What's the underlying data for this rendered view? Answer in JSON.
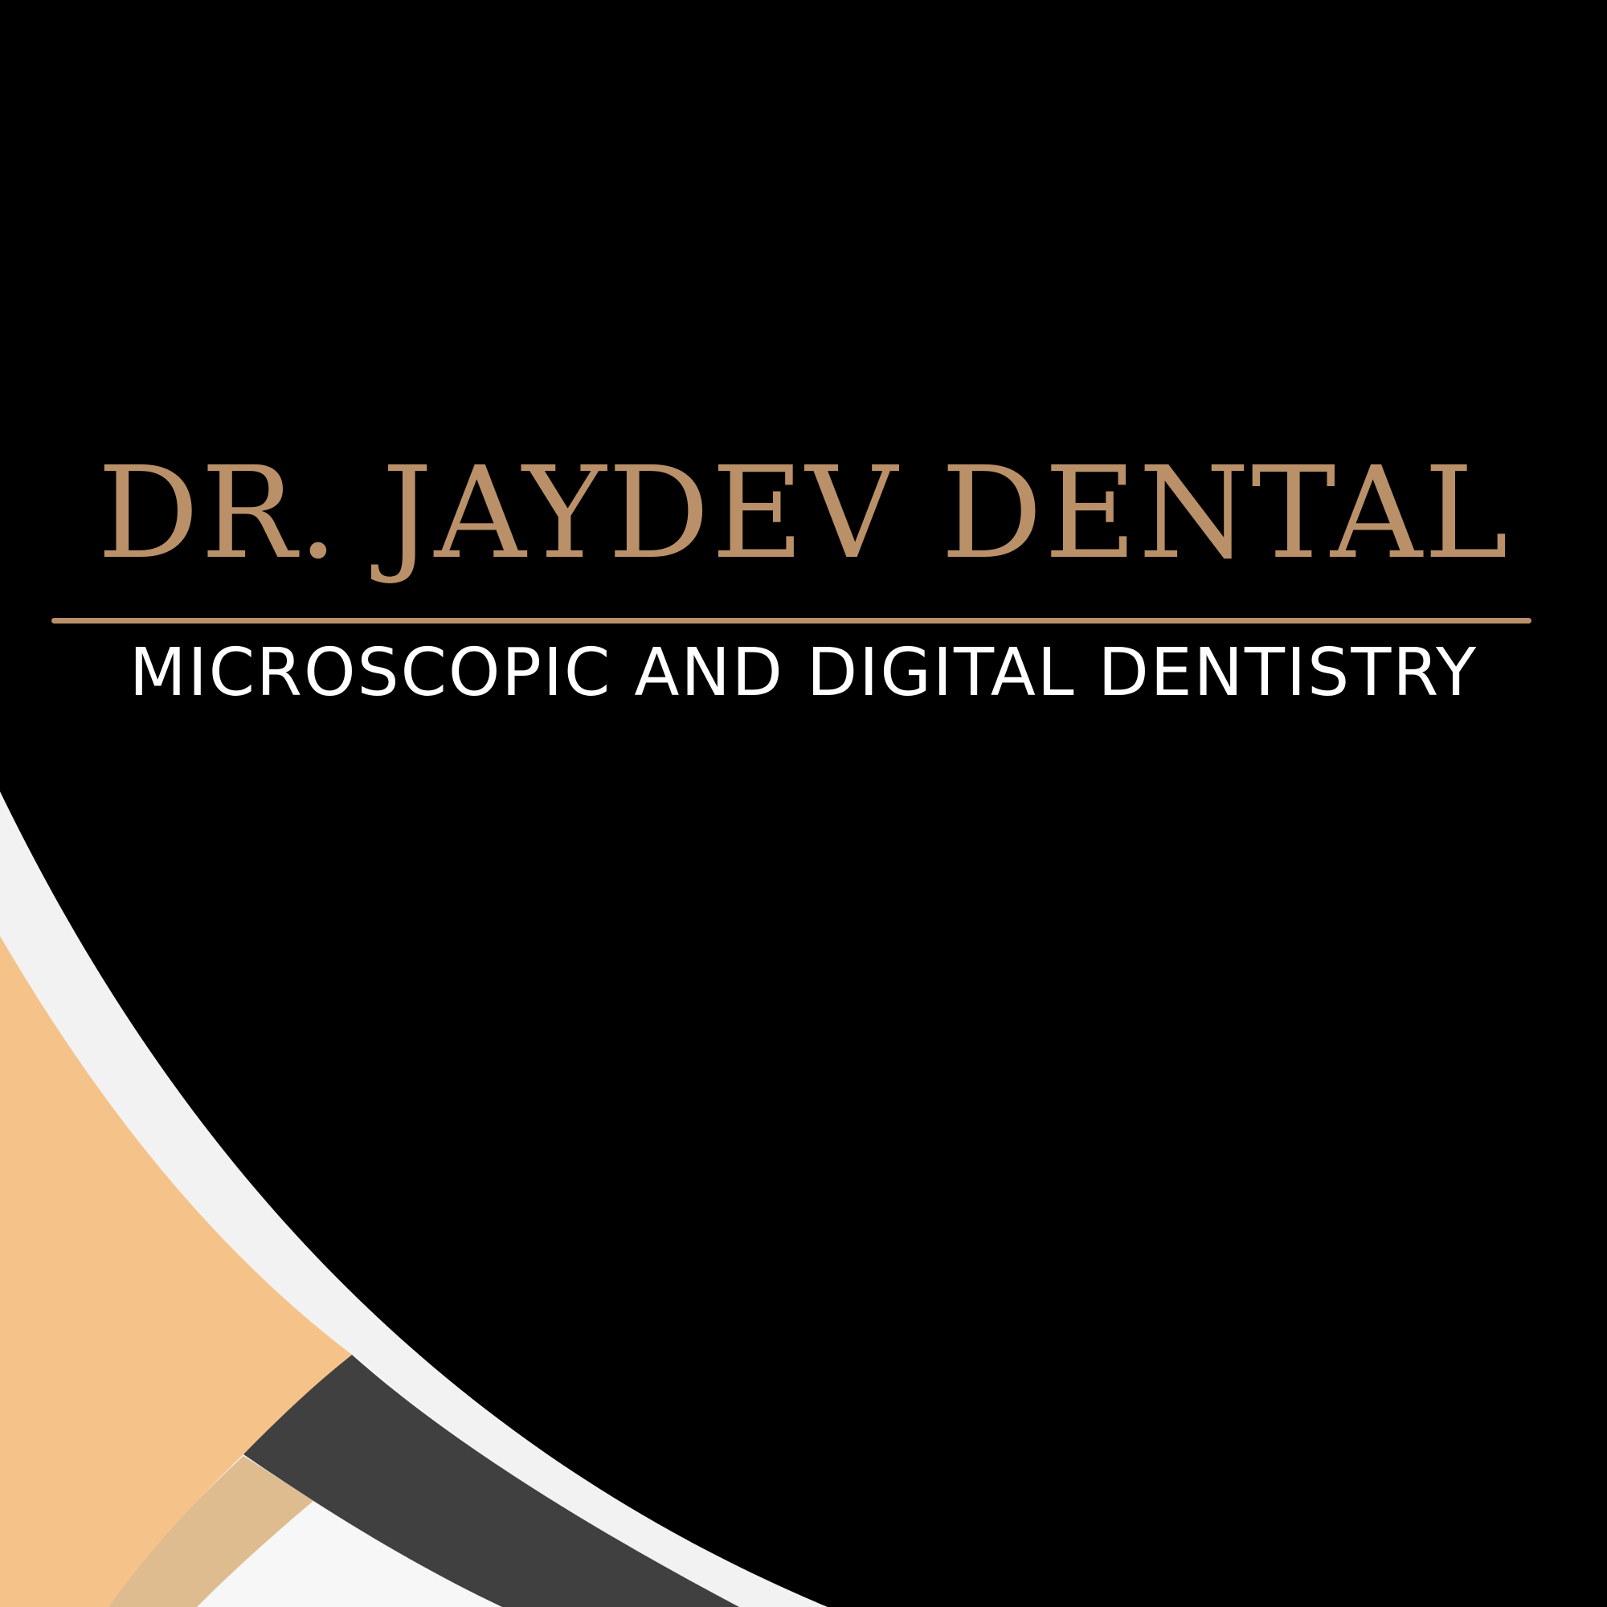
{
  "brand": {
    "name": "DR. JAYDEV DENTAL",
    "tagline": "MICROSCOPIC AND DIGITAL DENTISTRY"
  },
  "colors": {
    "background": "#000000",
    "gold_accent": "#b99068",
    "tagline_text": "#ffffff",
    "light_band": "#f2f2f2",
    "peach_band": "#f5c389",
    "tan_band": "#dfbc8f",
    "dark_gray_band": "#404040",
    "white_band": "#f7f7f7"
  }
}
